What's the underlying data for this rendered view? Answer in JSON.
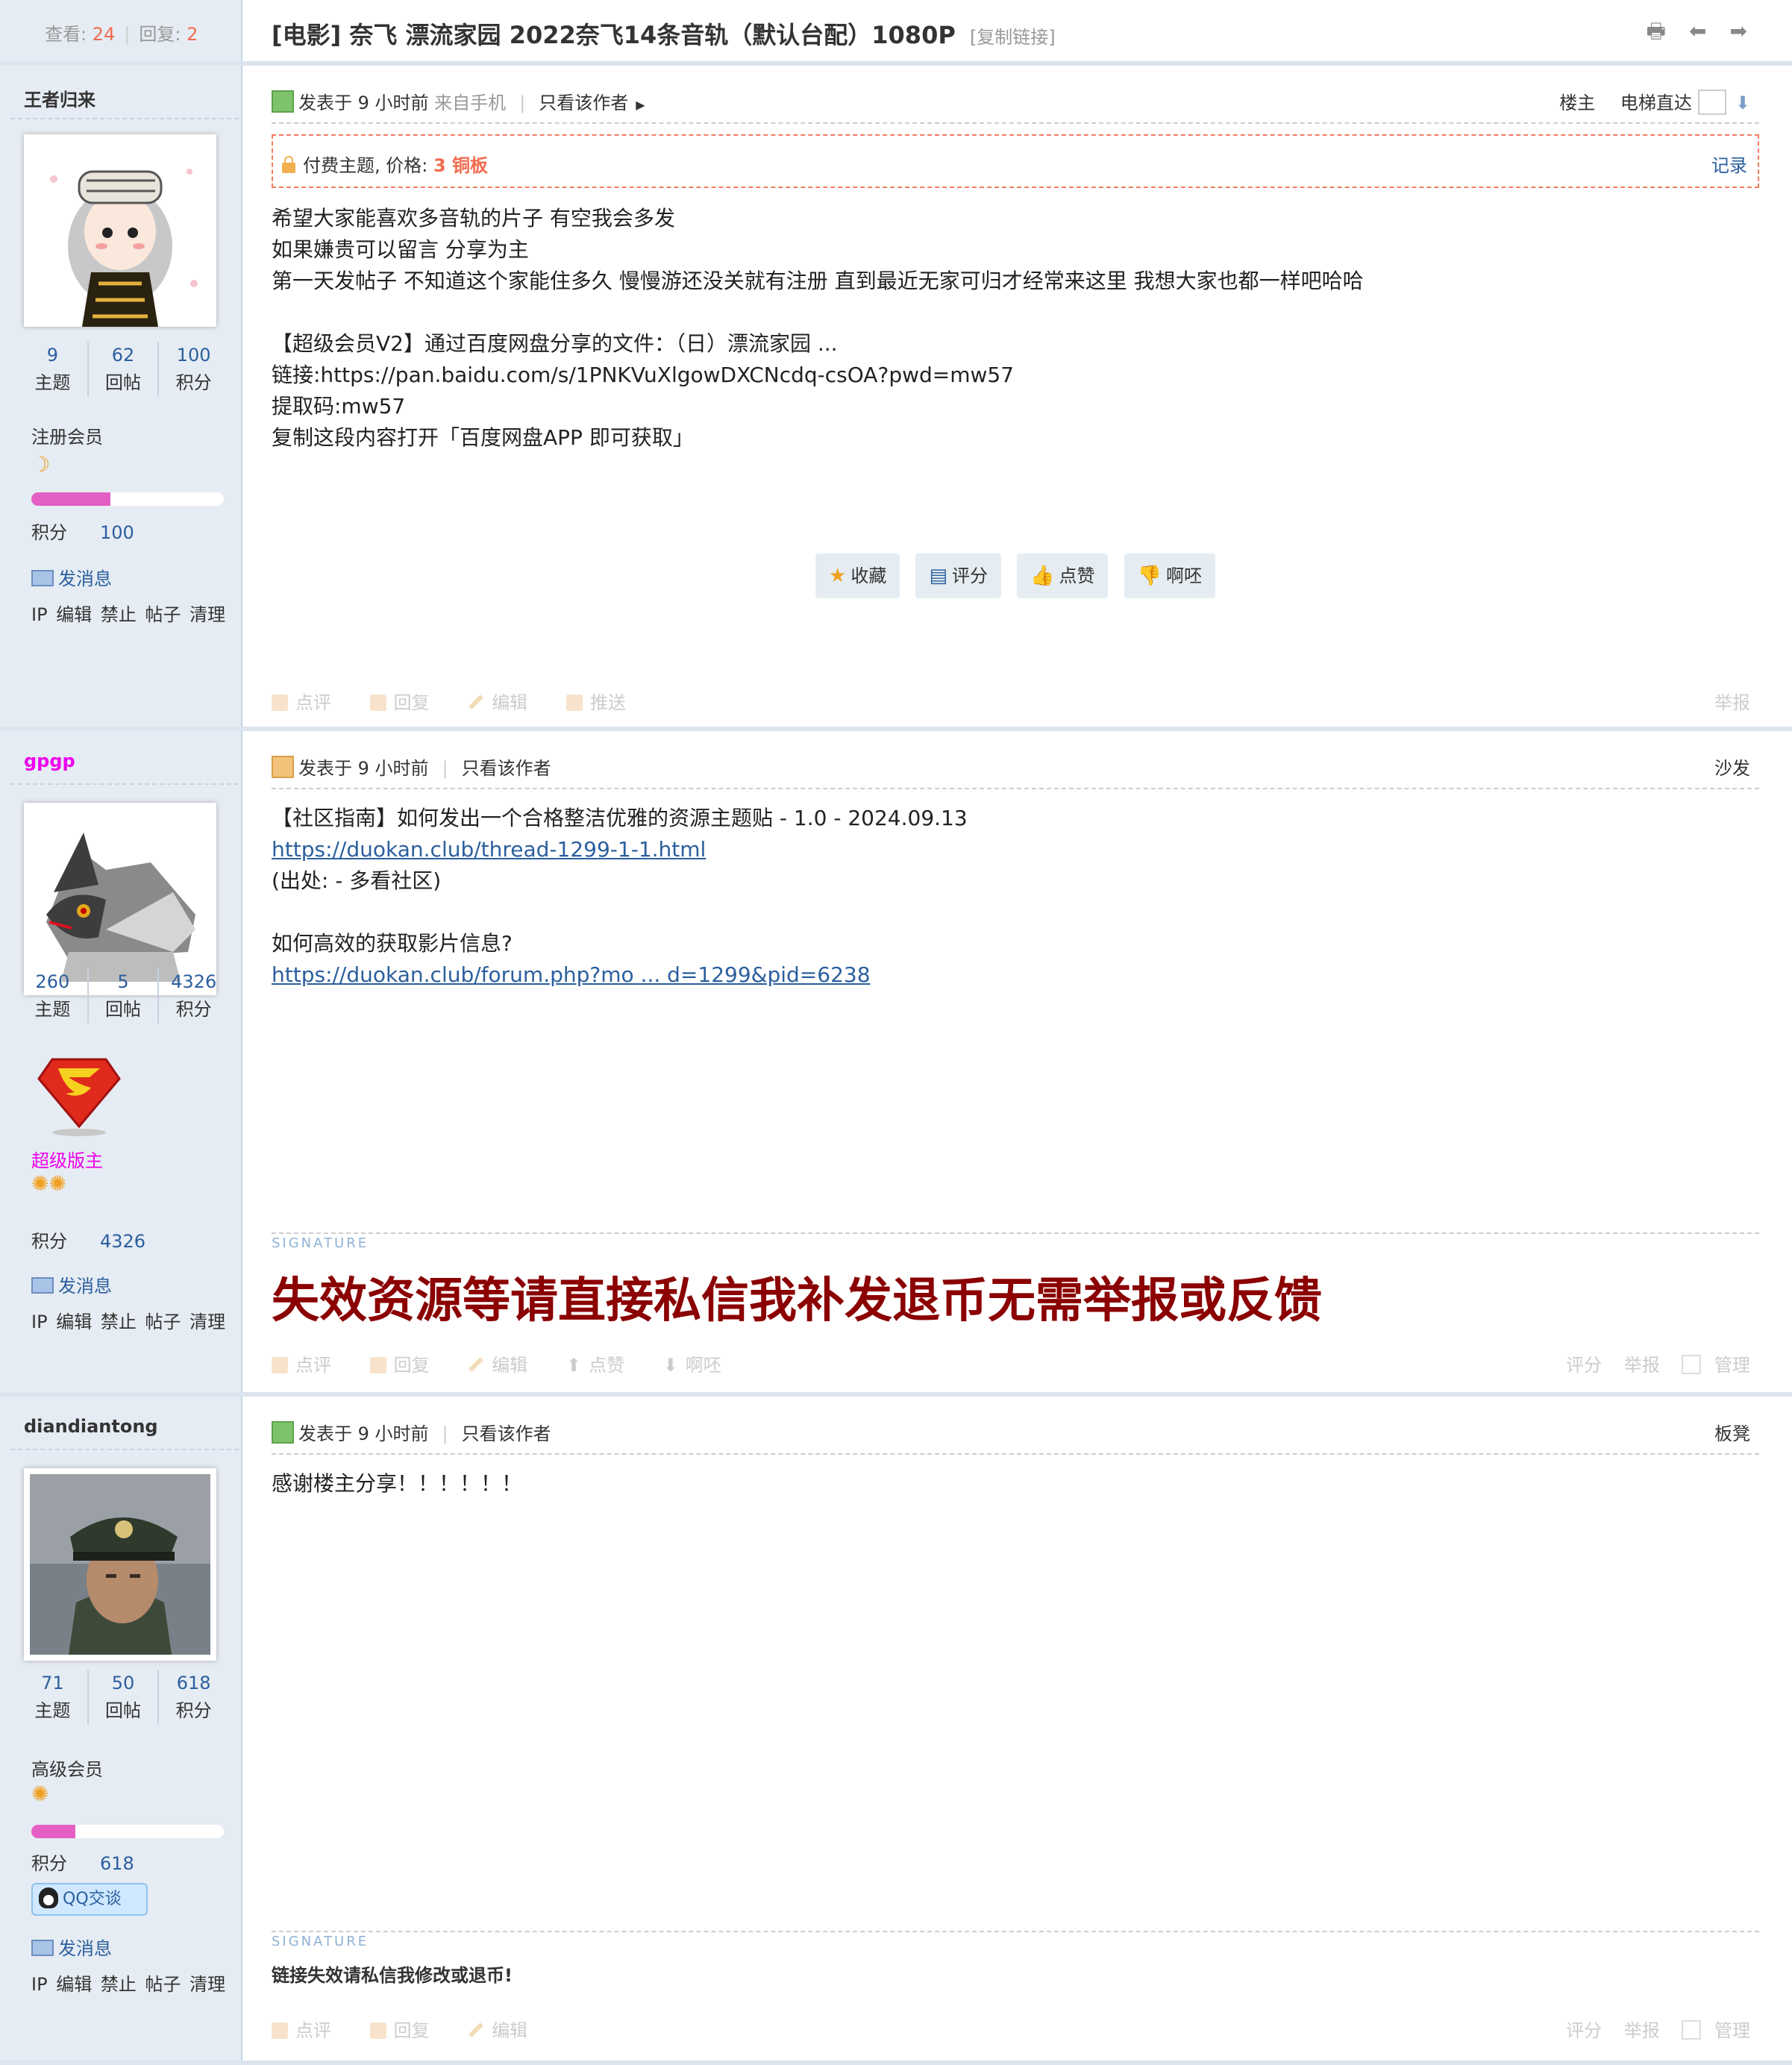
{
  "thread": {
    "views_label": "查看:",
    "views": "24",
    "replies_label": "回复:",
    "replies": "2",
    "title": "[电影] 奈飞 漂流家园 2022奈飞14条音轨（默认台配）1080P",
    "copy_link": "[复制链接]"
  },
  "labels": {
    "posted_at": "发表于 9 小时前",
    "from_mobile": "来自手机",
    "only_author": "只看该作者",
    "op": "楼主",
    "elevator": "电梯直达",
    "topics": "主题",
    "replies": "回帖",
    "points": "积分",
    "send_msg": "发消息",
    "admin_ip": "IP",
    "admin_edit": "编辑",
    "admin_ban": "禁止",
    "admin_posts": "帖子",
    "admin_clean": "清理",
    "signature": "SIGNATURE",
    "comment": "点评",
    "reply": "回复",
    "edit": "编辑",
    "push": "推送",
    "like": "点赞",
    "dislike": "啊呸",
    "rate": "评分",
    "report": "举报",
    "manage": "管理",
    "qq": "QQ交谈"
  },
  "posts": [
    {
      "floor": "楼主",
      "author": {
        "name": "王者归来",
        "topics": "9",
        "replies": "62",
        "points": "100",
        "group": "注册会员",
        "progress": 0.41
      },
      "paid": {
        "label": "付费主题, 价格:",
        "price": "3 铜板",
        "record": "记录"
      },
      "content": [
        "希望大家能喜欢多音轨的片子 有空我会多发",
        "如果嫌贵可以留言 分享为主",
        "第一天发帖子 不知道这个家能住多久 慢慢游还没关就有注册 直到最近无家可归才经常来这里 我想大家也都一样吧哈哈",
        "【超级会员V2】通过百度网盘分享的文件：（日）漂流家园 ...",
        "链接:https://pan.baidu.com/s/1PNKVuXlgowDXCNcdq-csOA?pwd=mw57",
        "提取码:mw57",
        "复制这段内容打开「百度网盘APP 即可获取」"
      ],
      "buttons": [
        "收藏",
        "评分",
        "点赞",
        "啊呸"
      ]
    },
    {
      "floor": "沙发",
      "author": {
        "name": "gpgp",
        "topics": "260",
        "replies": "5",
        "points": "4326",
        "group": "超级版主"
      },
      "content": [
        "【社区指南】如何发出一个合格整洁优雅的资源主题贴 - 1.0 - 2024.09.13",
        "https://duokan.club/thread-1299-1-1.html",
        "(出处: - 多看社区)",
        "如何高效的获取影片信息?",
        "https://duokan.club/forum.php?mo ... d=1299&pid=6238"
      ],
      "signature": "失效资源等请直接私信我补发退币无需举报或反馈"
    },
    {
      "floor": "板凳",
      "author": {
        "name": "diandiantong",
        "topics": "71",
        "replies": "50",
        "points": "618",
        "group": "高级会员",
        "progress": 0.23
      },
      "content": [
        "感谢楼主分享！！！！！！"
      ],
      "signature": "链接失效请私信我修改或退币!"
    }
  ],
  "colors": {
    "sidebar_bg": "#e6ecf3",
    "link": "#2b5f9e",
    "accent": "#f26c4f",
    "signature_red": "#8b0000",
    "moderator": "#ee00ee"
  }
}
